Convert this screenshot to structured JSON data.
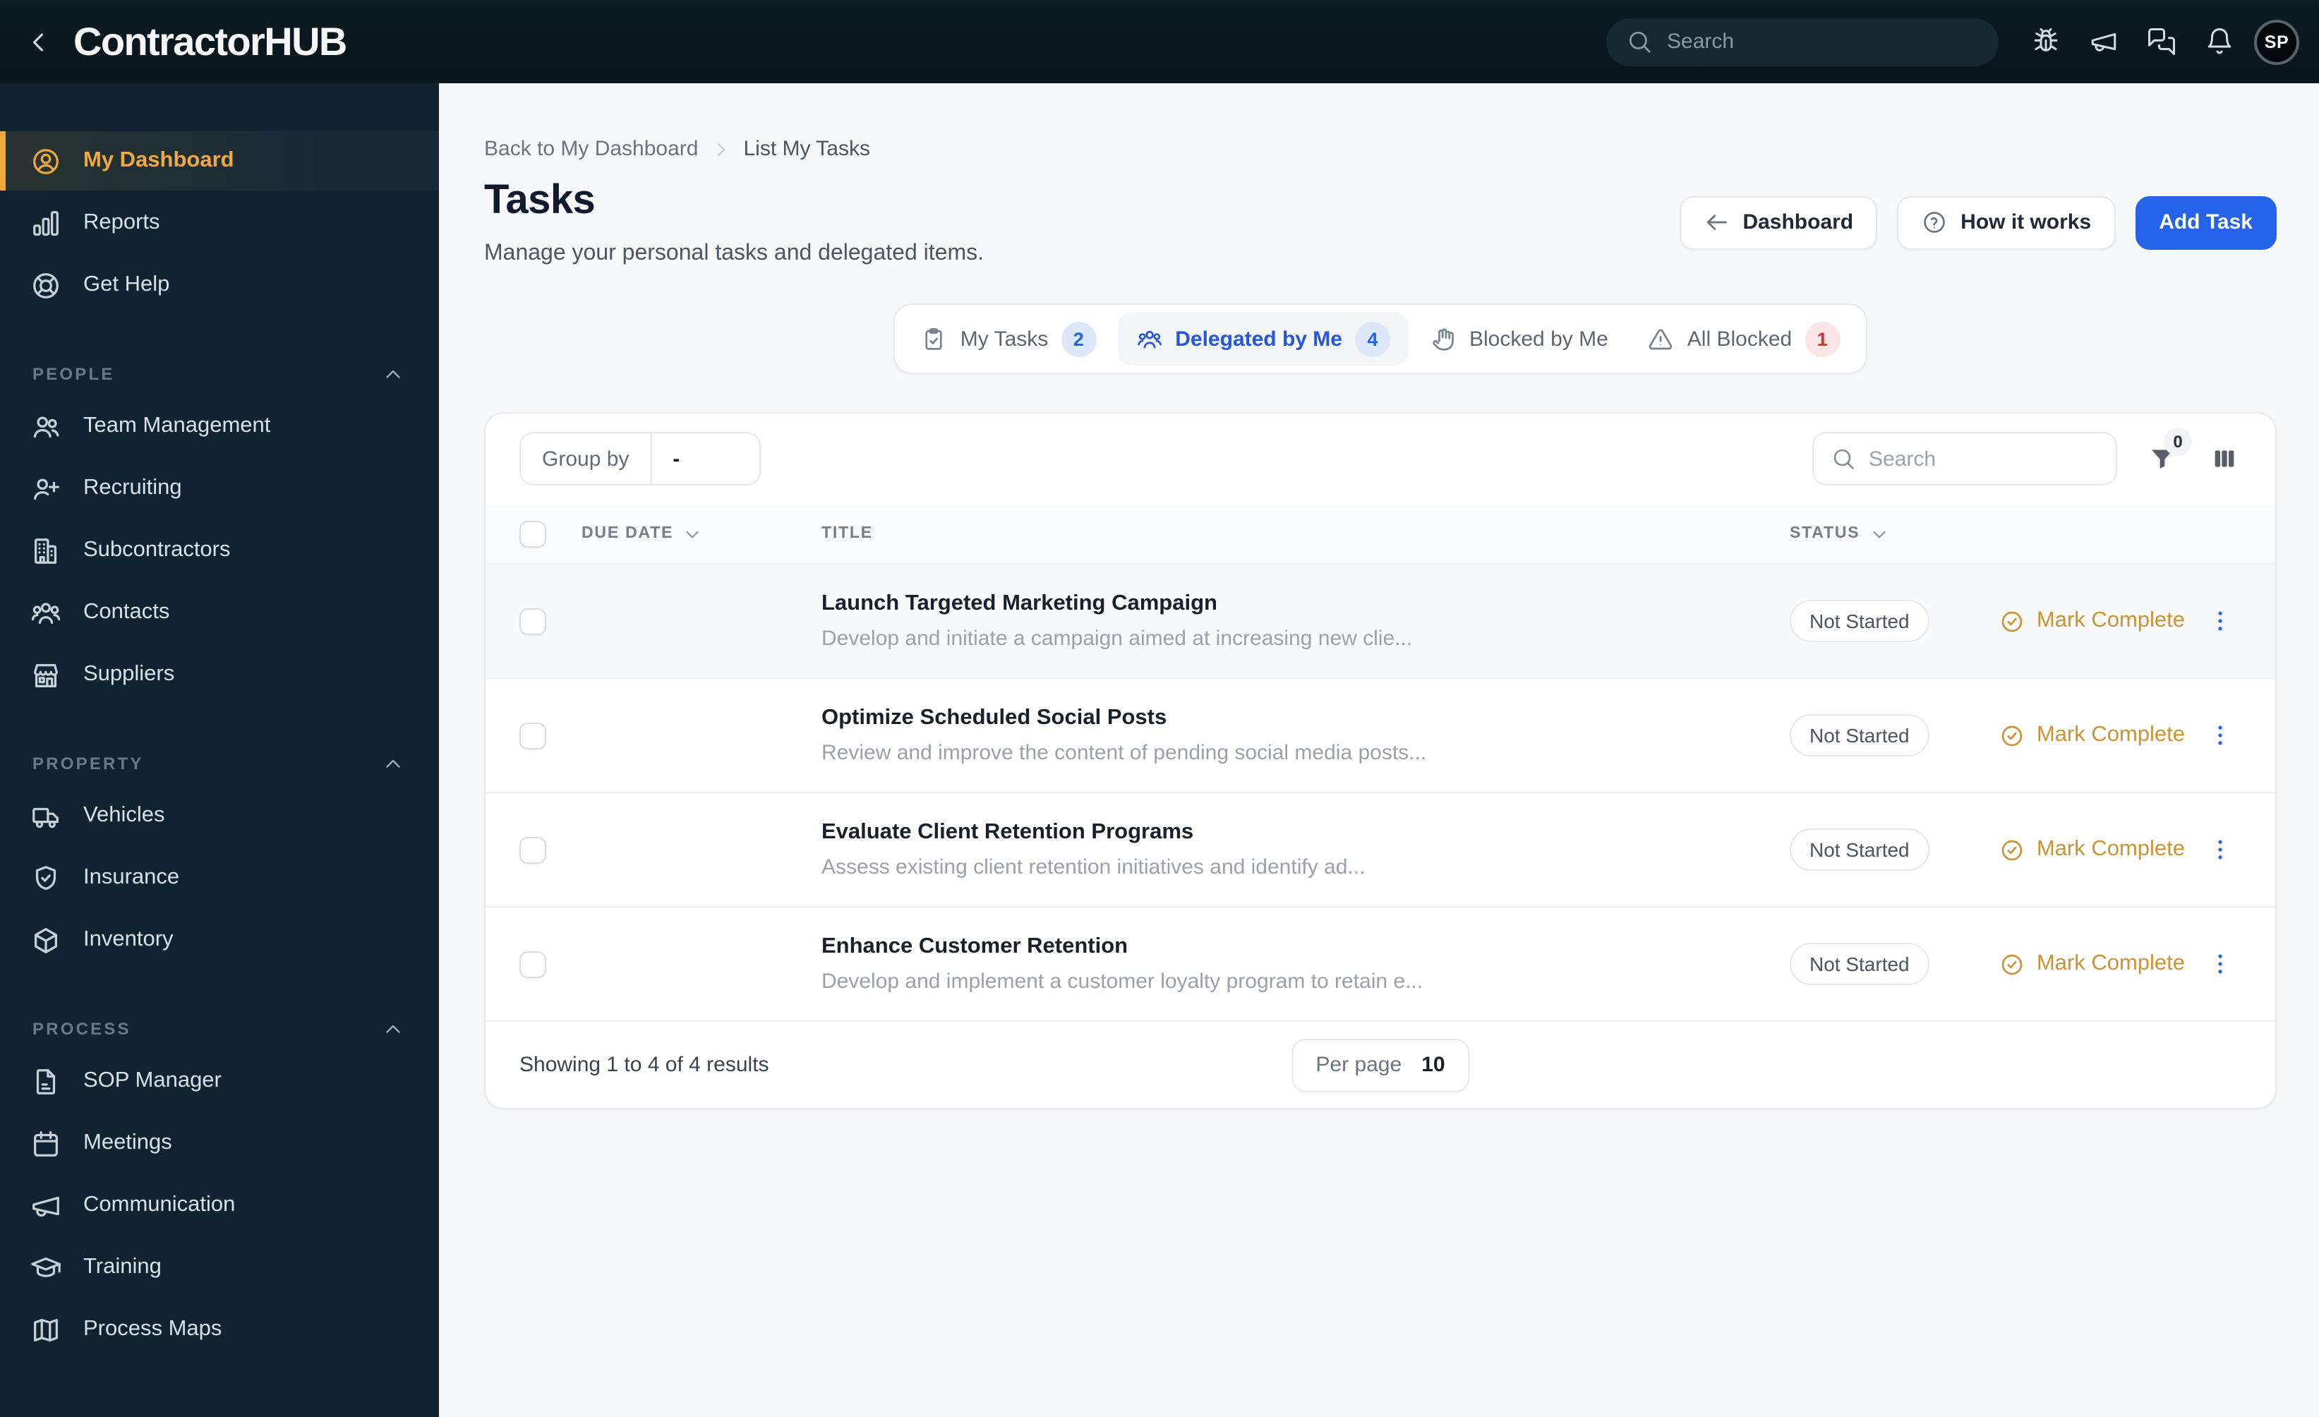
{
  "topbar": {
    "logo": "ContractorHUB",
    "search_placeholder": "Search",
    "avatar_initials": "SP"
  },
  "sidebar": {
    "items_top": [
      {
        "label": "My Dashboard"
      },
      {
        "label": "Reports"
      },
      {
        "label": "Get Help"
      }
    ],
    "sections": [
      {
        "title": "PEOPLE",
        "items": [
          "Team Management",
          "Recruiting",
          "Subcontractors",
          "Contacts",
          "Suppliers"
        ]
      },
      {
        "title": "PROPERTY",
        "items": [
          "Vehicles",
          "Insurance",
          "Inventory"
        ]
      },
      {
        "title": "PROCESS",
        "items": [
          "SOP Manager",
          "Meetings",
          "Communication",
          "Training",
          "Process Maps"
        ]
      }
    ]
  },
  "breadcrumb": {
    "back": "Back to My Dashboard",
    "current": "List My Tasks"
  },
  "page": {
    "title": "Tasks",
    "subtitle": "Manage your personal tasks and delegated items.",
    "dashboard_button": "Dashboard",
    "how_it_works_button": "How it works",
    "add_task_button": "Add Task"
  },
  "tabs": [
    {
      "label": "My Tasks",
      "count": "2"
    },
    {
      "label": "Delegated by Me",
      "count": "4"
    },
    {
      "label": "Blocked by Me",
      "count": ""
    },
    {
      "label": "All Blocked",
      "count": "1"
    }
  ],
  "toolbar": {
    "group_by_label": "Group by",
    "group_by_value": "-",
    "search_placeholder": "Search",
    "filter_count": "0"
  },
  "table": {
    "columns": {
      "due_date": "DUE DATE",
      "title": "TITLE",
      "status": "STATUS"
    },
    "rows": [
      {
        "title": "Launch Targeted Marketing Campaign",
        "description": "Develop and initiate a campaign aimed at increasing new clie...",
        "status": "Not Started",
        "action": "Mark Complete"
      },
      {
        "title": "Optimize Scheduled Social Posts",
        "description": "Review and improve the content of pending social media posts...",
        "status": "Not Started",
        "action": "Mark Complete"
      },
      {
        "title": "Evaluate Client Retention Programs",
        "description": "Assess existing client retention initiatives and identify ad...",
        "status": "Not Started",
        "action": "Mark Complete"
      },
      {
        "title": "Enhance Customer Retention",
        "description": "Develop and implement a customer loyalty program to retain e...",
        "status": "Not Started",
        "action": "Mark Complete"
      }
    ]
  },
  "footer": {
    "results_text": "Showing 1 to 4 of 4 results",
    "per_page_label": "Per page",
    "per_page_value": "10"
  },
  "colors": {
    "accent_blue": "#2563eb",
    "accent_amber": "#eda73c",
    "action_amber": "#cd9233",
    "badge_red": "#d03333",
    "topbar_bg": "#0b1820",
    "sidebar_bg": "#0f2430"
  }
}
